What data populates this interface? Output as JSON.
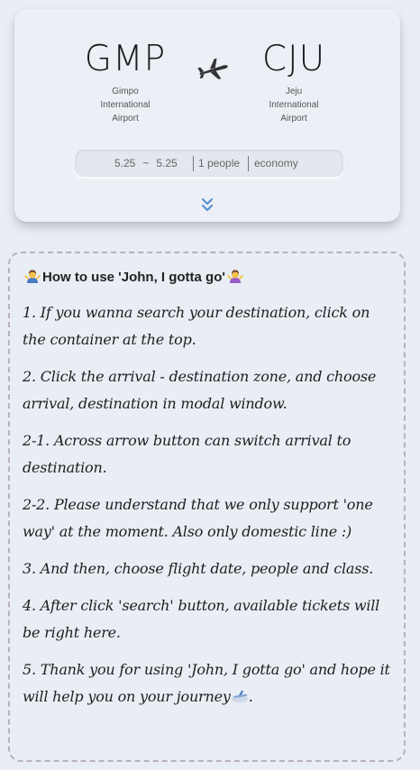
{
  "route": {
    "departure": {
      "code": "GMP",
      "name": "Gimpo International Airport"
    },
    "arrival": {
      "code": "CJU",
      "name": "Jeju International Airport"
    }
  },
  "search": {
    "date_from": "5.25",
    "date_tilde": "~",
    "date_to": "5.25",
    "people": "1 people",
    "class": "economy"
  },
  "guide": {
    "title": "How to use 'John, I gotta go'",
    "steps": [
      "1. If you wanna search your destination, click on the container at the top.",
      "2. Click the arrival - destination zone, and choose arrival, destination in modal window.",
      "2-1. Across arrow button can switch arrival to destination.",
      "2-2. Please understand that we only support 'one way' at the moment. Also only domestic line :)",
      "3. And then, choose flight date, people and class.",
      "4. After click 'search' button, available tickets will be right here.",
      "5. Thank you for using 'John, I gotta go' and hope it will help you on your journey"
    ]
  },
  "icons": {
    "plane": "airplane-icon",
    "expand": "double-chevron-down-icon",
    "person_left": "person-shrugging-emoji",
    "person_right": "person-shrugging-emoji",
    "journey": "airplane-emoji"
  },
  "colors": {
    "accent": "#5b8fd6",
    "card_bg": "#eceff5",
    "page_bg": "#e9edf4",
    "guide_border": "#b9b2ba"
  }
}
